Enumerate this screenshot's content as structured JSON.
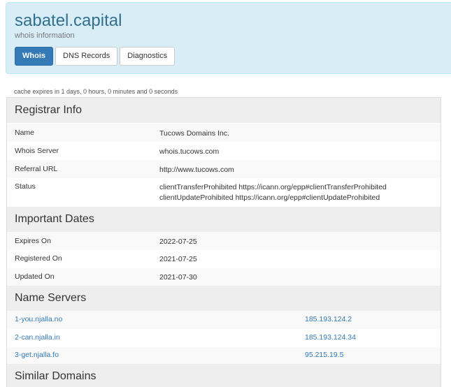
{
  "header": {
    "domain": "sabatel.capital",
    "subtitle": "whois information",
    "tabs": [
      {
        "label": "Whois",
        "active": true
      },
      {
        "label": "DNS Records",
        "active": false
      },
      {
        "label": "Diagnostics",
        "active": false
      }
    ]
  },
  "cache_note": "cache expires in 1 days, 0 hours, 0 minutes and 0 seconds",
  "registrar": {
    "title": "Registrar Info",
    "rows": [
      {
        "label": "Name",
        "value": "Tucows Domains Inc."
      },
      {
        "label": "Whois Server",
        "value": "whois.tucows.com"
      },
      {
        "label": "Referral URL",
        "value": "http://www.tucows.com"
      },
      {
        "label": "Status",
        "value_lines": [
          "clientTransferProhibited https://icann.org/epp#clientTransferProhibited",
          "clientUpdateProhibited https://icann.org/epp#clientUpdateProhibited"
        ]
      }
    ]
  },
  "dates": {
    "title": "Important Dates",
    "rows": [
      {
        "label": "Expires On",
        "value": "2022-07-25"
      },
      {
        "label": "Registered On",
        "value": "2021-07-25"
      },
      {
        "label": "Updated On",
        "value": "2021-07-30"
      }
    ]
  },
  "nameservers": {
    "title": "Name Servers",
    "rows": [
      {
        "host": "1-you.njalla.no",
        "ip": "185.193.124.2"
      },
      {
        "host": "2-can.njalla.in",
        "ip": "185.193.124.34"
      },
      {
        "host": "3-get.njalla.fo",
        "ip": "95.215.19.5"
      }
    ]
  },
  "similar": {
    "title": "Similar Domains"
  },
  "colors": {
    "header_bg": "#d9edf7",
    "title_color": "#31708f",
    "active_tab": "#337ab7",
    "link": "#337ab7",
    "section_bg": "#eeeeee"
  }
}
